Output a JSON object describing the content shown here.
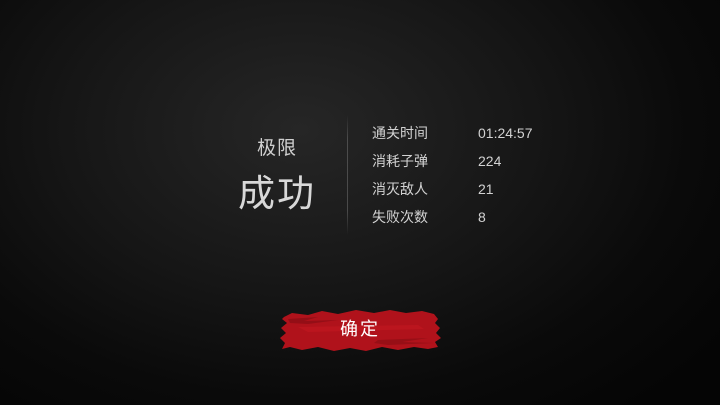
{
  "result_screen": {
    "difficulty": "极限",
    "outcome": "成功",
    "stats": [
      {
        "label": "通关时间",
        "value": "01:24:57"
      },
      {
        "label": "消耗子弹",
        "value": "224"
      },
      {
        "label": "消灭敌人",
        "value": "21"
      },
      {
        "label": "失败次数",
        "value": "8"
      }
    ],
    "confirm_label": "确定",
    "colors": {
      "button_red": "#b0121b",
      "text": "#d2d2d2"
    }
  }
}
